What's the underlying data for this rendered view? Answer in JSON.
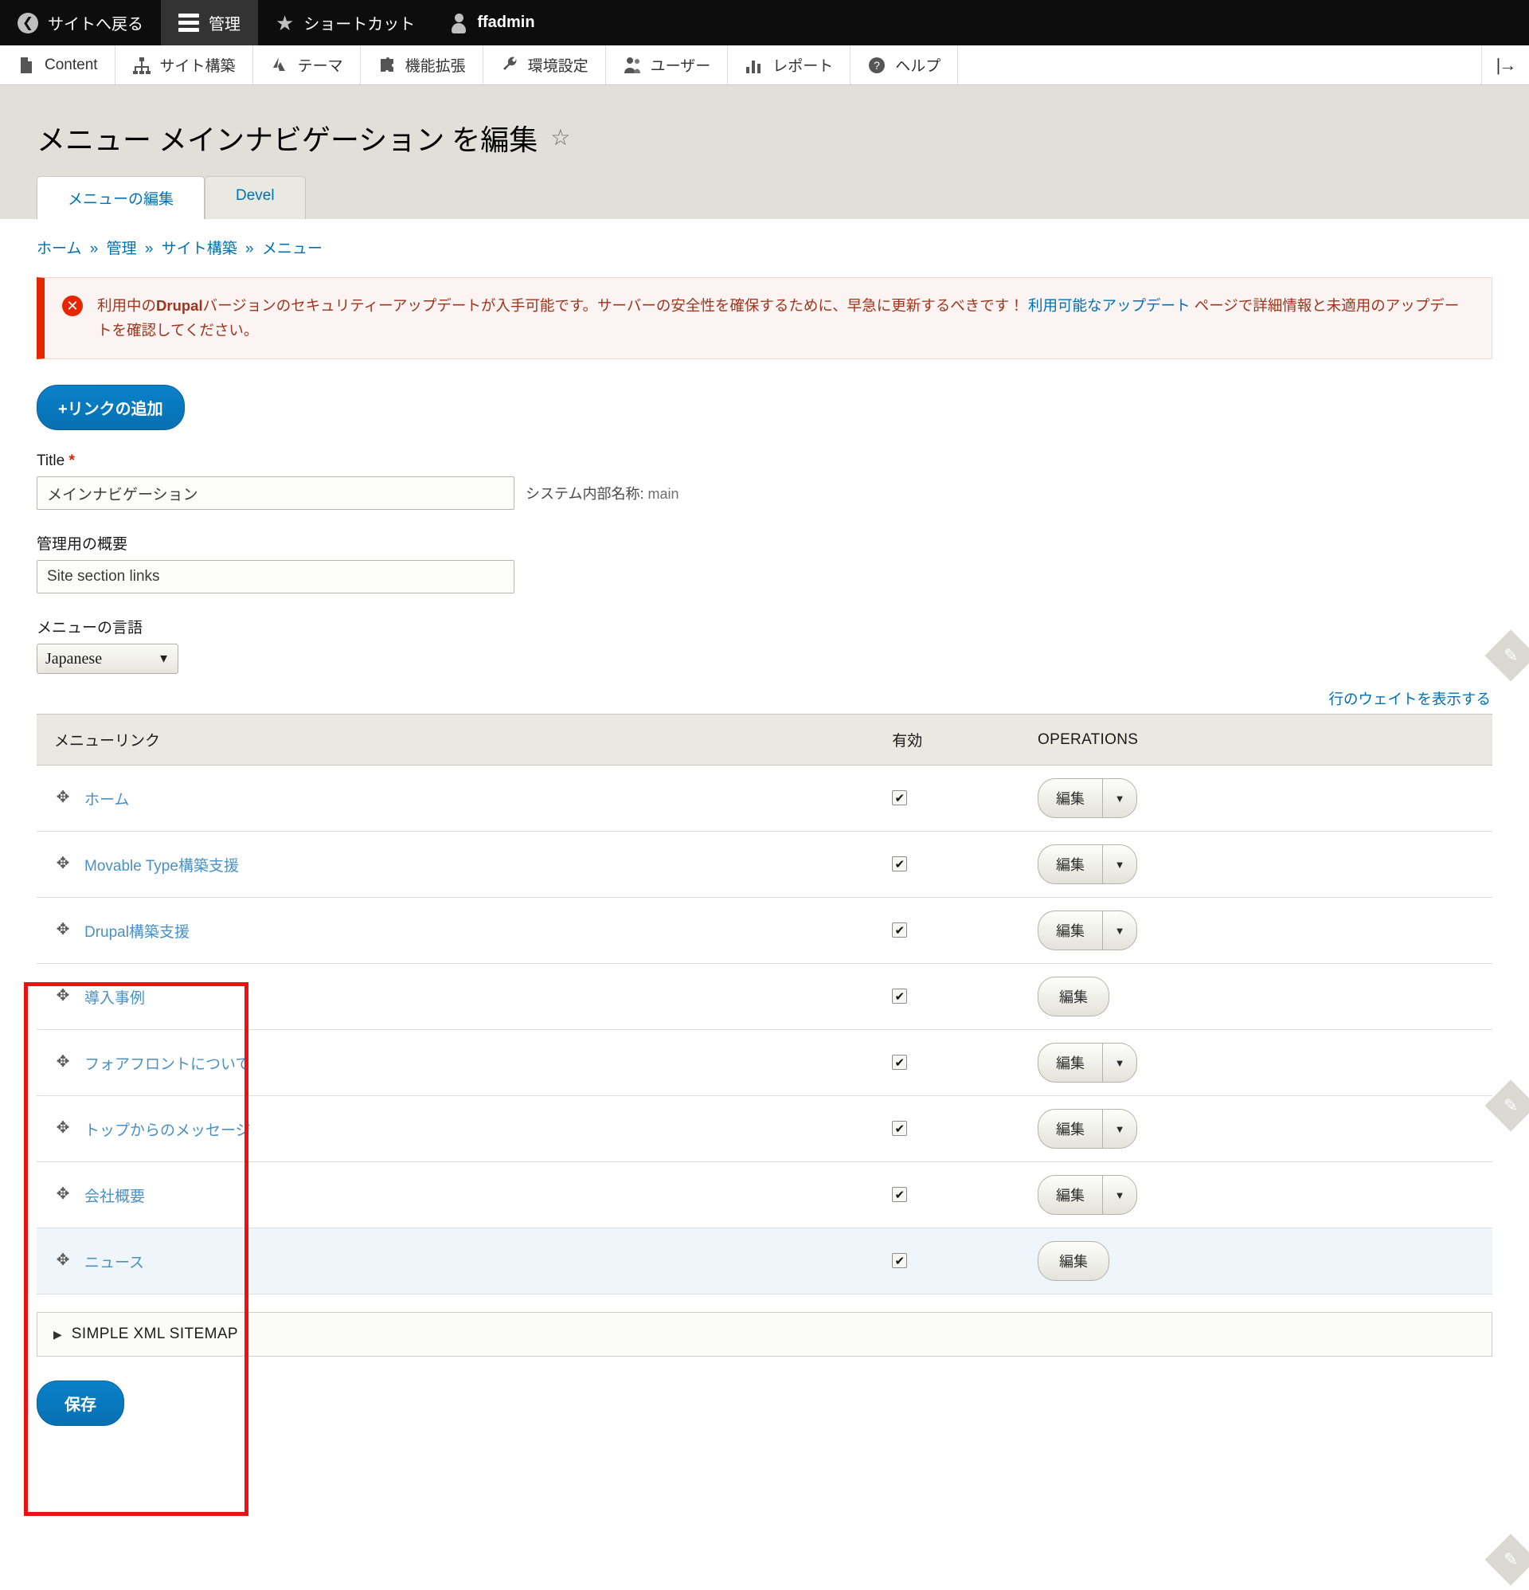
{
  "admin_bar": {
    "items": [
      {
        "label": "サイトへ戻る",
        "icon": "back-circle-icon",
        "active": false
      },
      {
        "label": "管理",
        "icon": "hamburger-icon",
        "active": true
      },
      {
        "label": "ショートカット",
        "icon": "star-icon",
        "active": false
      },
      {
        "label": "ffadmin",
        "icon": "person-icon",
        "active": false
      }
    ]
  },
  "toolbar": {
    "items": [
      {
        "label": "Content",
        "icon": "file-icon"
      },
      {
        "label": "サイト構築",
        "icon": "sitemap-icon"
      },
      {
        "label": "テーマ",
        "icon": "paint-icon"
      },
      {
        "label": "機能拡張",
        "icon": "puzzle-icon"
      },
      {
        "label": "環境設定",
        "icon": "wrench-icon"
      },
      {
        "label": "ユーザー",
        "icon": "people-icon"
      },
      {
        "label": "レポート",
        "icon": "bar-chart-icon"
      },
      {
        "label": "ヘルプ",
        "icon": "question-circle-icon"
      }
    ],
    "collapse_icon": "collapse-panel-icon"
  },
  "page": {
    "title": "メニュー メインナビゲーション を編集",
    "star_icon": "star-outline-icon"
  },
  "tabs": [
    {
      "label": "メニューの編集",
      "active": true
    },
    {
      "label": "Devel",
      "active": false
    }
  ],
  "breadcrumb": {
    "separator": "»",
    "items": [
      "ホーム",
      "管理",
      "サイト構築",
      "メニュー"
    ]
  },
  "message": {
    "icon": "error-circle-icon",
    "part1": "利用中の",
    "bold": "Drupal",
    "part2": "バージョンのセキュリティーアップデートが入手可能です。サーバーの安全性を確保するために、早急に更新するべきです！ ",
    "link": "利用可能なアップデート",
    "part3": " ページで詳細情報と未適用のアップデートを確認してください。"
  },
  "form": {
    "add_link_button": "+リンクの追加",
    "title_label": "Title",
    "title_required_mark": "*",
    "title_value": "メインナビゲーション",
    "machine_name_label": "システム内部名称:",
    "machine_name_value": "main",
    "admin_summary_label": "管理用の概要",
    "admin_summary_value": "Site section links",
    "language_label": "メニューの言語",
    "language_value": "Japanese",
    "language_options": [
      "Japanese"
    ],
    "save_button": "保存"
  },
  "row_weights_link": "行のウェイトを表示する",
  "table": {
    "headers": {
      "menu_link": "メニューリンク",
      "enabled": "有効",
      "operations": "OPERATIONS"
    },
    "rows": [
      {
        "label": "ホーム",
        "enabled": true,
        "edit": "編集",
        "has_dropdown": true,
        "highlighted": false
      },
      {
        "label": "Movable Type構築支援",
        "enabled": true,
        "edit": "編集",
        "has_dropdown": true,
        "highlighted": false
      },
      {
        "label": "Drupal構築支援",
        "enabled": true,
        "edit": "編集",
        "has_dropdown": true,
        "highlighted": false
      },
      {
        "label": "導入事例",
        "enabled": true,
        "edit": "編集",
        "has_dropdown": false,
        "highlighted": false
      },
      {
        "label": "フォアフロントについて",
        "enabled": true,
        "edit": "編集",
        "has_dropdown": true,
        "highlighted": false
      },
      {
        "label": "トップからのメッセージ",
        "enabled": true,
        "edit": "編集",
        "has_dropdown": true,
        "highlighted": false
      },
      {
        "label": "会社概要",
        "enabled": true,
        "edit": "編集",
        "has_dropdown": true,
        "highlighted": false
      },
      {
        "label": "ニュース",
        "enabled": true,
        "edit": "編集",
        "has_dropdown": false,
        "highlighted": true
      }
    ],
    "checkbox_glyph": "✔",
    "drag_icon": "drag-handle-icon",
    "dropdown_glyph": "▼"
  },
  "sitemap_section": {
    "triangle": "▶",
    "title": "SIMPLE XML SITEMAP"
  },
  "colors": {
    "accent_blue": "#0071b3",
    "button_blue": "#0678be",
    "error_red": "#e62600",
    "highlight_box_red": "#ee1111",
    "header_bg": "#e0e0d8",
    "admin_bar_bg": "#0d0d0d"
  }
}
